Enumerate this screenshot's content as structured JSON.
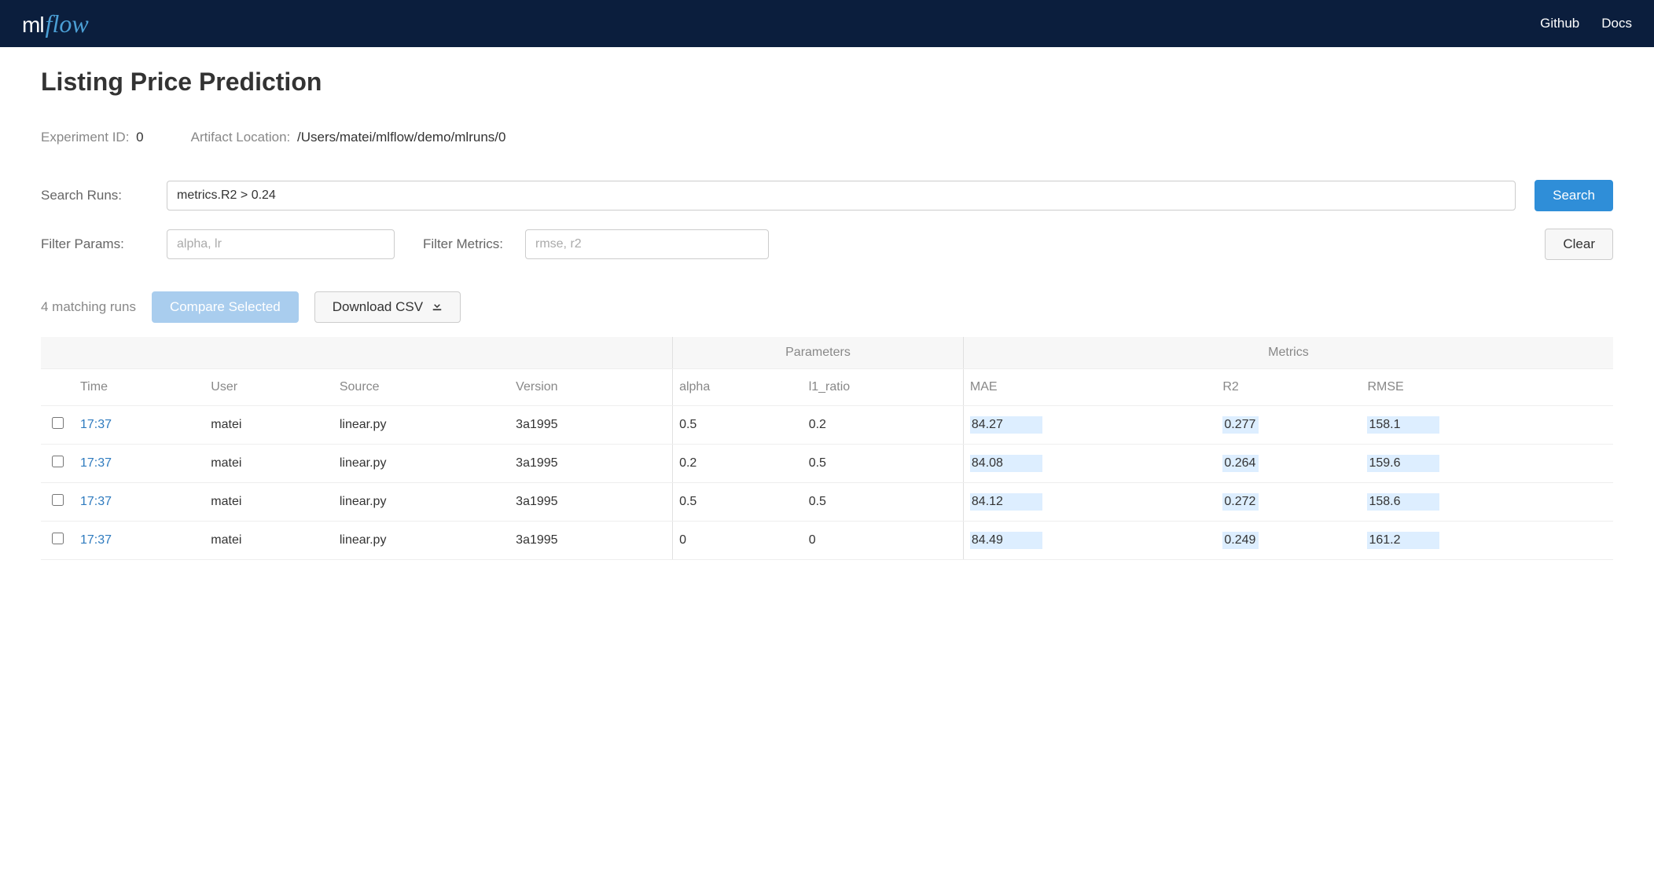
{
  "nav": {
    "github": "Github",
    "docs": "Docs",
    "logo_ml": "ml",
    "logo_flow": "flow"
  },
  "page": {
    "title": "Listing Price Prediction",
    "experiment_id_label": "Experiment ID:",
    "experiment_id_value": "0",
    "artifact_location_label": "Artifact Location:",
    "artifact_location_value": "/Users/matei/mlflow/demo/mlruns/0"
  },
  "search": {
    "label": "Search Runs:",
    "value": "metrics.R2 > 0.24",
    "button": "Search"
  },
  "filter": {
    "params_label": "Filter Params:",
    "params_placeholder": "alpha, lr",
    "metrics_label": "Filter Metrics:",
    "metrics_placeholder": "rmse, r2",
    "clear_button": "Clear"
  },
  "actions": {
    "matching": "4 matching runs",
    "compare": "Compare Selected",
    "download": "Download CSV"
  },
  "table": {
    "group_params": "Parameters",
    "group_metrics": "Metrics",
    "cols": {
      "time": "Time",
      "user": "User",
      "source": "Source",
      "version": "Version",
      "alpha": "alpha",
      "l1_ratio": "l1_ratio",
      "mae": "MAE",
      "r2": "R2",
      "rmse": "RMSE"
    },
    "rows": [
      {
        "time": "17:37",
        "user": "matei",
        "source": "linear.py",
        "version": "3a1995",
        "alpha": "0.5",
        "l1_ratio": "0.2",
        "mae": "84.27",
        "r2": "0.277",
        "rmse": "158.1"
      },
      {
        "time": "17:37",
        "user": "matei",
        "source": "linear.py",
        "version": "3a1995",
        "alpha": "0.2",
        "l1_ratio": "0.5",
        "mae": "84.08",
        "r2": "0.264",
        "rmse": "159.6"
      },
      {
        "time": "17:37",
        "user": "matei",
        "source": "linear.py",
        "version": "3a1995",
        "alpha": "0.5",
        "l1_ratio": "0.5",
        "mae": "84.12",
        "r2": "0.272",
        "rmse": "158.6"
      },
      {
        "time": "17:37",
        "user": "matei",
        "source": "linear.py",
        "version": "3a1995",
        "alpha": "0",
        "l1_ratio": "0",
        "mae": "84.49",
        "r2": "0.249",
        "rmse": "161.2"
      }
    ]
  }
}
